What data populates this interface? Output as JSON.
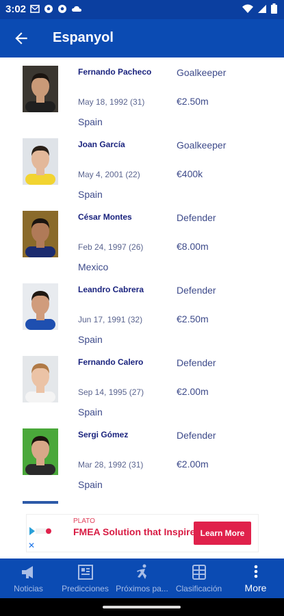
{
  "status_bar": {
    "time": "3:02",
    "left_icons": [
      "mail-icon",
      "soccer-ball-icon",
      "soccer-ball-icon",
      "cloud-icon"
    ],
    "right_icons": [
      "wifi-icon",
      "signal-icon",
      "battery-icon"
    ]
  },
  "header": {
    "title": "Espanyol"
  },
  "players": [
    {
      "name": "Fernando Pacheco",
      "position": "Goalkeeper",
      "dob": "May 18, 1992 (31)",
      "value": "€2.50m",
      "nationality": "Spain",
      "photo_bg": "#3a3630",
      "shirt": "#1f1f1f",
      "hair": "#1a1410",
      "skin": "#c99a78"
    },
    {
      "name": "Joan García",
      "position": "Goalkeeper",
      "dob": "May 4, 2001 (22)",
      "value": "€400k",
      "nationality": "Spain",
      "photo_bg": "#dfe3e8",
      "shirt": "#f2d431",
      "hair": "#2a2018",
      "skin": "#e3b89a"
    },
    {
      "name": "César Montes",
      "position": "Defender",
      "dob": "Feb 24, 1997 (26)",
      "value": "€8.00m",
      "nationality": "Mexico",
      "photo_bg": "#8a6a2a",
      "shirt": "#1a2a6e",
      "hair": "#1a1410",
      "skin": "#b07a58"
    },
    {
      "name": "Leandro Cabrera",
      "position": "Defender",
      "dob": "Jun 17, 1991 (32)",
      "value": "€2.50m",
      "nationality": "Spain",
      "photo_bg": "#e8ebef",
      "shirt": "#1e4fb0",
      "hair": "#1f1812",
      "skin": "#d09c7c"
    },
    {
      "name": "Fernando Calero",
      "position": "Defender",
      "dob": "Sep 14, 1995 (27)",
      "value": "€2.00m",
      "nationality": "Spain",
      "photo_bg": "#e4e7ea",
      "shirt": "#f4f4f4",
      "hair": "#b07a46",
      "skin": "#ebc3a6"
    },
    {
      "name": "Sergi Gómez",
      "position": "Defender",
      "dob": "Mar 28, 1992 (31)",
      "value": "€2.00m",
      "nationality": "Spain",
      "photo_bg": "#4aa83a",
      "shirt": "#2a2a2a",
      "hair": "#1c140e",
      "skin": "#d8a888"
    },
    {
      "name": "",
      "position": "",
      "dob": "",
      "value": "",
      "nationality": "",
      "photo_bg": "#2d5aa8",
      "shirt": "#1e4fb0",
      "hair": "#1c140e",
      "skin": "#d8a888"
    }
  ],
  "ad": {
    "brand": "PLATO",
    "headline": "FMEA Solution that Inspires",
    "cta": "Learn More",
    "accent": "#e0214b"
  },
  "bottom_nav": [
    {
      "label": "Noticias",
      "icon": "megaphone-icon"
    },
    {
      "label": "Predicciones",
      "icon": "news-icon"
    },
    {
      "label": "Próximos pa...",
      "icon": "runner-icon"
    },
    {
      "label": "Clasificación",
      "icon": "table-icon"
    },
    {
      "label": "More",
      "icon": "more-vertical-icon",
      "active": true
    }
  ],
  "colors": {
    "primary": "#0b4bb3",
    "status_bar": "#0b3fa0",
    "name_text": "#1a237e"
  }
}
